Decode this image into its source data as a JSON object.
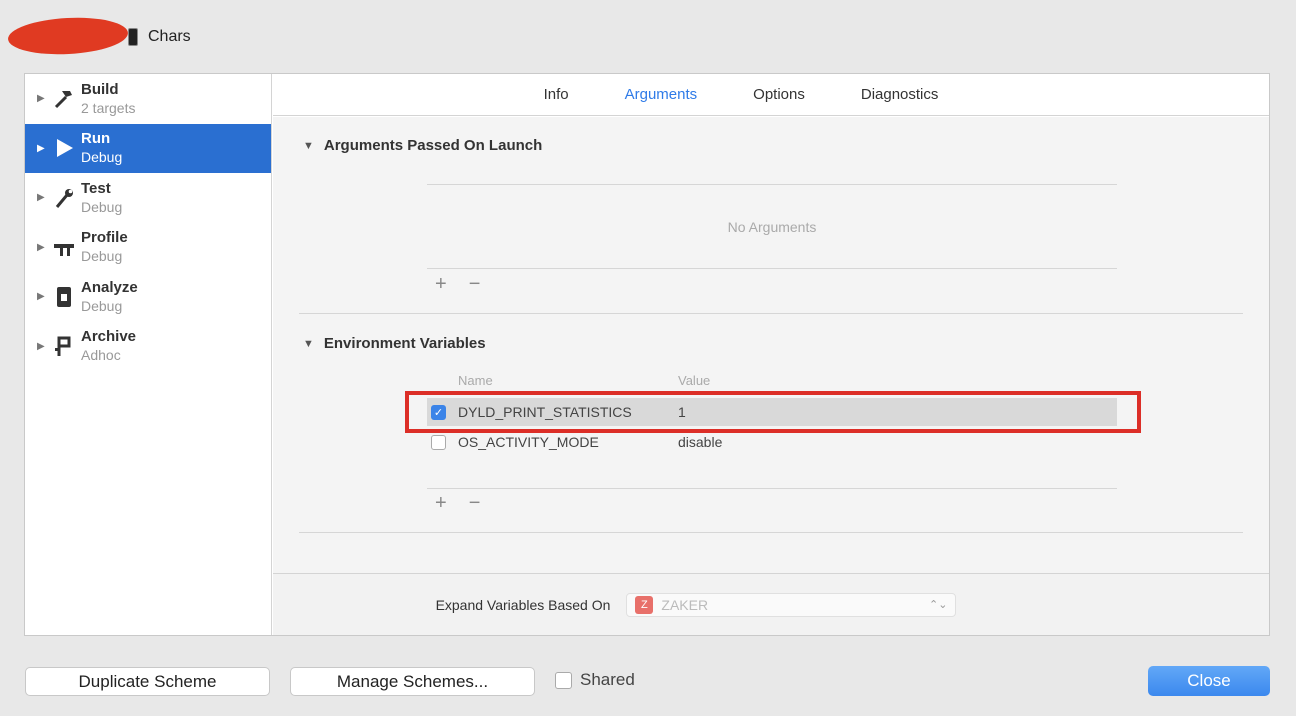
{
  "scheme": {
    "name": "Chars"
  },
  "sidebar": {
    "items": [
      {
        "title": "Build",
        "subtitle": "2 targets",
        "icon": "hammer-icon"
      },
      {
        "title": "Run",
        "subtitle": "Debug",
        "icon": "play-icon"
      },
      {
        "title": "Test",
        "subtitle": "Debug",
        "icon": "wrench-icon"
      },
      {
        "title": "Profile",
        "subtitle": "Debug",
        "icon": "instruments-icon"
      },
      {
        "title": "Analyze",
        "subtitle": "Debug",
        "icon": "analyze-icon"
      },
      {
        "title": "Archive",
        "subtitle": "Adhoc",
        "icon": "archive-icon"
      }
    ],
    "selected_index": 1
  },
  "tabs": {
    "info": "Info",
    "arguments": "Arguments",
    "options": "Options",
    "diagnostics": "Diagnostics",
    "active": "Arguments"
  },
  "arguments": {
    "header": "Arguments Passed On Launch",
    "empty_text": "No Arguments",
    "add": "+",
    "remove": "−"
  },
  "env": {
    "header": "Environment Variables",
    "col_name": "Name",
    "col_value": "Value",
    "rows": [
      {
        "name": "DYLD_PRINT_STATISTICS",
        "value": "1",
        "checked": true
      },
      {
        "name": "OS_ACTIVITY_MODE",
        "value": "disable",
        "checked": false
      }
    ],
    "add": "+",
    "remove": "−"
  },
  "expand": {
    "label": "Expand Variables Based On",
    "value": "ZAKER",
    "app_icon_letter": "Z"
  },
  "buttons": {
    "duplicate": "Duplicate Scheme",
    "manage": "Manage Schemes...",
    "shared": "Shared",
    "close": "Close"
  },
  "colors": {
    "selection": "#2a6fd1",
    "accent": "#2f7be8",
    "highlight_box": "#dc2e27"
  }
}
